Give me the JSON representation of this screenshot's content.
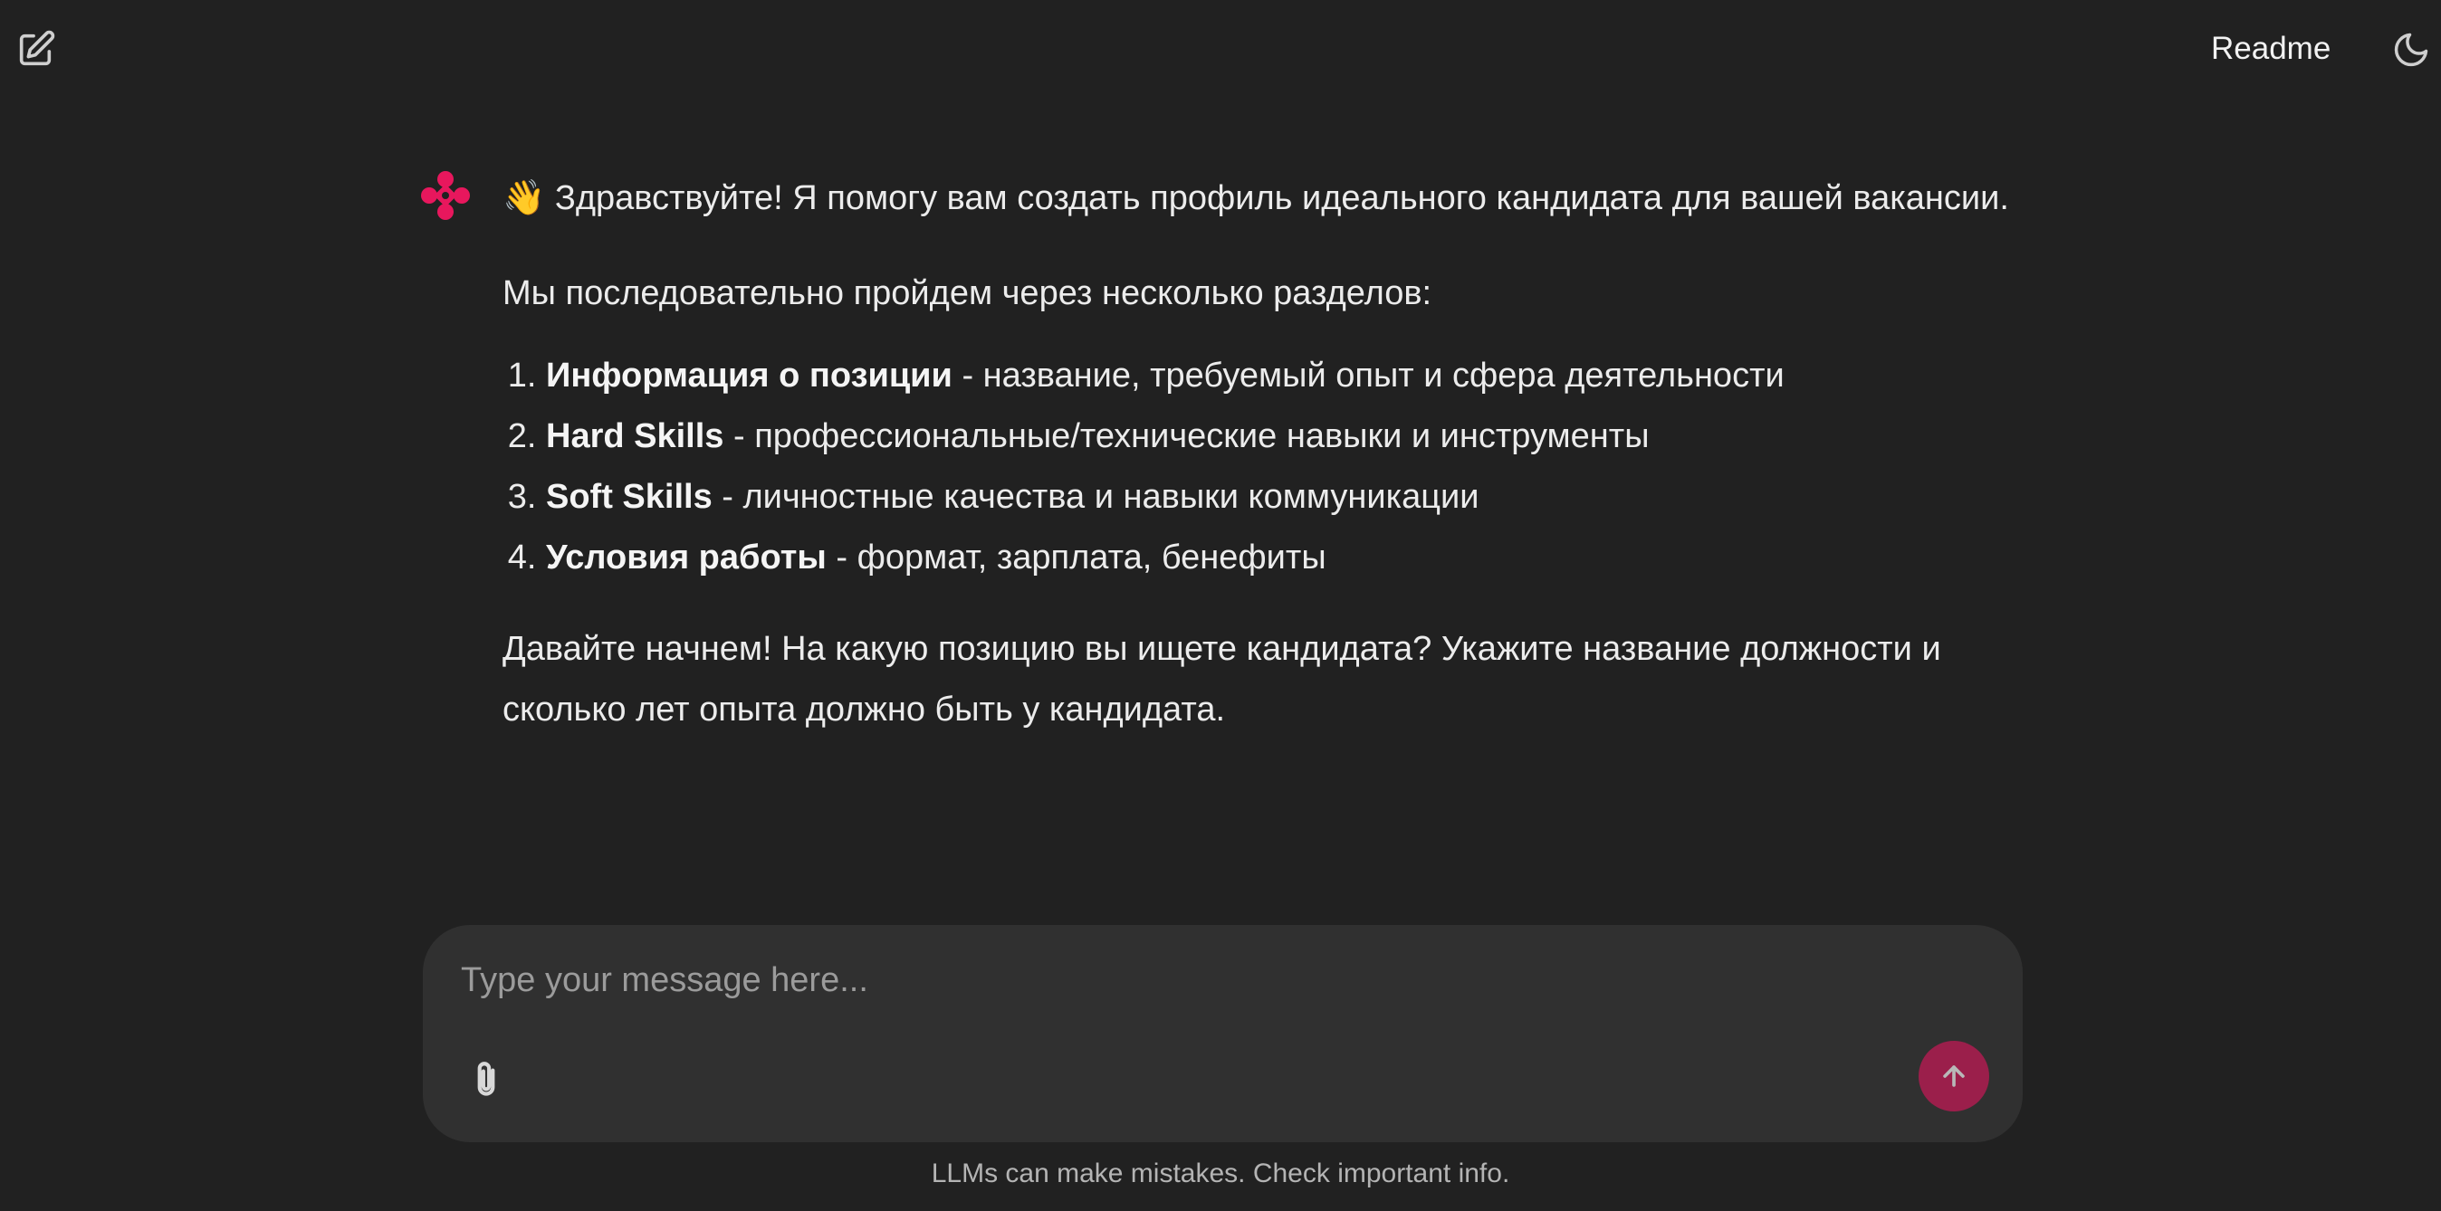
{
  "header": {
    "new_chat_icon": "edit-icon",
    "readme_label": "Readme",
    "theme_icon": "moon-icon"
  },
  "message": {
    "avatar_icon": "sparkle-logo",
    "accent_color": "#e8175d",
    "intro": "👋 Здравствуйте! Я помогу вам создать профиль идеального кандидата для вашей вакансии.",
    "sections_intro": "Мы последовательно пройдем через несколько разделов:",
    "sections": [
      {
        "title": "Информация о позиции",
        "description": " - название, требуемый опыт и сфера деятельности"
      },
      {
        "title": "Hard Skills",
        "description": " - профессиональные/технические навыки и инструменты"
      },
      {
        "title": "Soft Skills",
        "description": " - личностные качества и навыки коммуникации"
      },
      {
        "title": "Условия работы",
        "description": " - формат, зарплата, бенефиты"
      }
    ],
    "closing": "Давайте начнем! На какую позицию вы ищете кандидата? Укажите название должности и сколько лет опыта должно быть у кандидата."
  },
  "composer": {
    "placeholder": "Type your message here...",
    "value": "",
    "attach_icon": "paperclip-icon",
    "send_icon": "arrow-up-icon",
    "send_color": "#9b1f4b"
  },
  "footer": {
    "disclaimer": "LLMs can make mistakes. Check important info."
  }
}
